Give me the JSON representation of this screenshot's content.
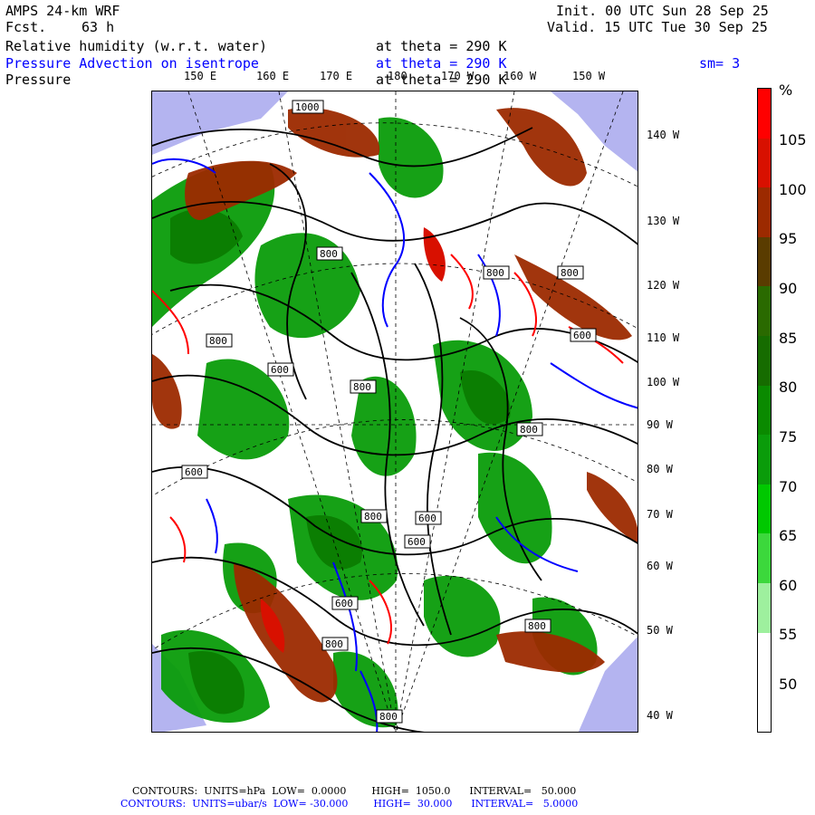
{
  "header": {
    "model": "AMPS 24-km WRF",
    "fcst_label": "Fcst.",
    "fcst_value": "63 h",
    "init": "Init. 00 UTC Sun 28 Sep 25",
    "valid": "Valid. 15 UTC Tue 30 Sep 25"
  },
  "fields": {
    "f1_name": "Relative humidity (w.r.t. water)",
    "f1_level": "at theta = 290 K",
    "f2_name": "Pressure Advection on isentrope",
    "f2_level": "at theta = 290 K",
    "f2_smooth": "sm= 3",
    "f3_name": "Pressure",
    "f3_level": "at theta = 290 K"
  },
  "map": {
    "top_lon_labels": [
      "150 E",
      "160 E",
      "170 E",
      "180",
      "170 W",
      "160 W",
      "150 W"
    ],
    "right_lon_labels": [
      "140 W",
      "130 W",
      "120 W",
      "110 W",
      "100 W",
      "90 W",
      "80 W",
      "70 W",
      "60 W",
      "50 W",
      "40 W"
    ],
    "contour_labels": [
      "1000",
      "800",
      "800",
      "800",
      "600",
      "800",
      "600",
      "800",
      "800",
      "600",
      "800",
      "600",
      "600",
      "600",
      "800",
      "800",
      "800",
      "600"
    ]
  },
  "colorbar": {
    "unit": "%",
    "labels": [
      "105",
      "100",
      "95",
      "90",
      "85",
      "80",
      "75",
      "70",
      "65",
      "60",
      "55",
      "50"
    ],
    "colors": [
      "#ff0000",
      "#d81000",
      "#9c2a00",
      "#5a3c00",
      "#2a6a00",
      "#166c00",
      "#0a8a00",
      "#0a9c0a",
      "#00c800",
      "#3cd83c",
      "#9ef09e",
      "#ffffff",
      "#ffffff"
    ]
  },
  "footer": {
    "line1": "CONTOURS:  UNITS=hPa  LOW=  0.0000        HIGH=  1050.0      INTERVAL=   50.000",
    "line2": "CONTOURS:  UNITS=ubar/s  LOW= -30.000        HIGH=  30.000      INTERVAL=   5.0000"
  }
}
